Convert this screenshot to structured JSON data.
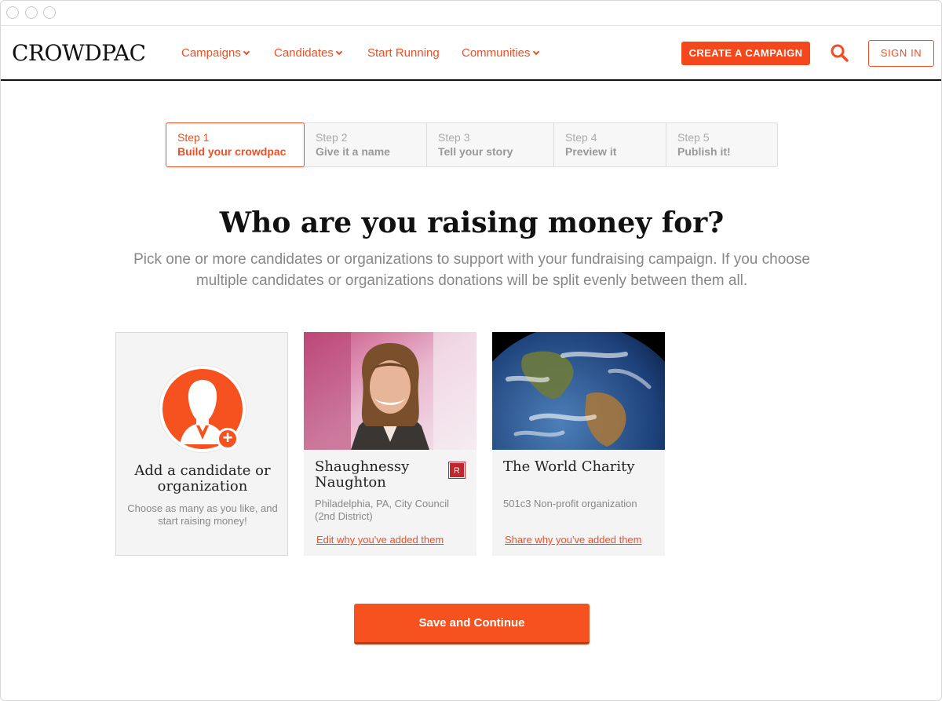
{
  "brand": {
    "logo": "CROWDPAC",
    "accent": "#f04e23"
  },
  "nav": {
    "items": [
      {
        "label": "Campaigns",
        "dropdown": true
      },
      {
        "label": "Candidates",
        "dropdown": true
      },
      {
        "label": "Start Running",
        "dropdown": false
      },
      {
        "label": "Communities",
        "dropdown": true
      }
    ],
    "create_label": "CREATE A CAMPAIGN",
    "signin_label": "SIGN IN"
  },
  "steps": [
    {
      "num": "Step 1",
      "label": "Build your crowdpac",
      "active": true
    },
    {
      "num": "Step 2",
      "label": "Give it a name",
      "active": false
    },
    {
      "num": "Step 3",
      "label": "Tell your story",
      "active": false
    },
    {
      "num": "Step 4",
      "label": "Preview it",
      "active": false
    },
    {
      "num": "Step 5",
      "label": "Publish it!",
      "active": false
    }
  ],
  "main": {
    "heading": "Who are you raising money for?",
    "subtext": "Pick one or more candidates or organizations to support with your fundraising campaign. If you choose multiple candidates or organizations donations will be split evenly between them all."
  },
  "add_card": {
    "title": "Add a candidate or organization",
    "desc": "Choose as many as you like, and start raising money!",
    "icon": "add-person-icon"
  },
  "cards": [
    {
      "name": "Shaughnessy Naughton",
      "party": "R",
      "desc": "Philadelphia, PA, City Council (2nd District)",
      "link": "Edit why you've added them"
    },
    {
      "name": "The World Charity",
      "desc": "501c3 Non-profit organization",
      "link": "Share why you've added them"
    }
  ],
  "save_label": "Save and Continue"
}
